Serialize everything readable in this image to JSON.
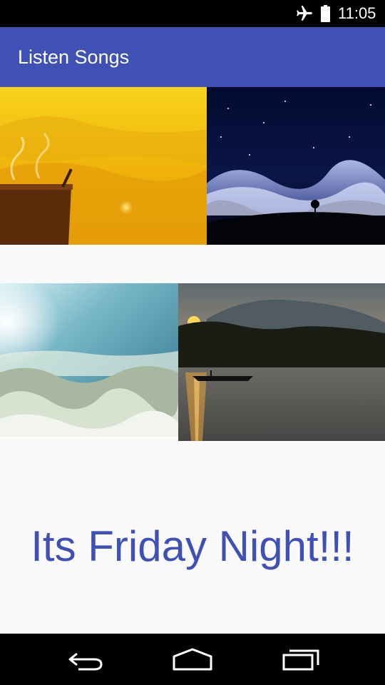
{
  "status_bar": {
    "time": "11:05",
    "icons": [
      "airplane-mode-icon",
      "battery-icon"
    ]
  },
  "app_bar": {
    "title": "Listen Songs"
  },
  "gallery": {
    "images": [
      {
        "name": "sunrise-tea-image",
        "description_icon": "photo"
      },
      {
        "name": "night-moon-image",
        "description_icon": "photo"
      },
      {
        "name": "sky-clouds-image",
        "description_icon": "photo"
      },
      {
        "name": "sunset-river-image",
        "description_icon": "photo"
      }
    ]
  },
  "main": {
    "headline": "Its Friday Night!!!"
  },
  "nav_bar": {
    "buttons": [
      "back-icon",
      "home-icon",
      "recents-icon"
    ]
  },
  "colors": {
    "primary": "#3f51b5",
    "background": "#fafafa",
    "status_bar": "#000000"
  }
}
